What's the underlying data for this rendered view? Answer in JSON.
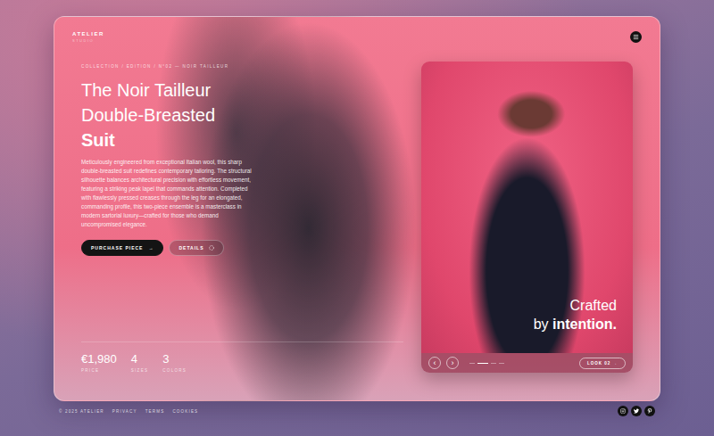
{
  "brand": {
    "name": "ATELIER",
    "tagline": "STUDIO"
  },
  "breadcrumb": "COLLECTION / EDITION / N°02 — NOIR TAILLEUR",
  "title": {
    "lines": [
      "The Noir Tailleur",
      "Double-Breasted"
    ],
    "emphasis": "Suit"
  },
  "description": "Meticulously engineered from exceptional Italian wool, this sharp double-breasted suit redefines contemporary tailoring. The structural silhouette balances architectural precision with effortless movement, featuring a striking peak lapel that commands attention. Completed with flawlessly pressed creases through the leg for an elongated, commanding profile, this two-piece ensemble is a masterclass in modern sartorial luxury—crafted for those who demand uncompromised elegance.",
  "buttons": [
    {
      "label": "PURCHASE PIECE",
      "icon": "→",
      "kind": "primary"
    },
    {
      "label": "DETAILS",
      "icon": "",
      "kind": "secondary"
    }
  ],
  "stats": [
    {
      "value": "€1,980",
      "label": "PRICE"
    },
    {
      "value": "4",
      "label": "SIZES"
    },
    {
      "value": "3",
      "label": "COLORS"
    }
  ],
  "showcase": {
    "line1": "Crafted",
    "line2_lead": "by",
    "line2_emphasis": "intention."
  },
  "carousel": {
    "prev": "‹",
    "next": "›",
    "slides": [
      {
        "selected": false
      },
      {
        "selected": true
      },
      {
        "selected": false
      },
      {
        "selected": false
      }
    ],
    "look_button": "LOOK 02 →"
  },
  "footer": {
    "copyright": "© 2025 ATELIER",
    "links": [
      "PRIVACY",
      "TERMS",
      "COOKIES"
    ]
  }
}
